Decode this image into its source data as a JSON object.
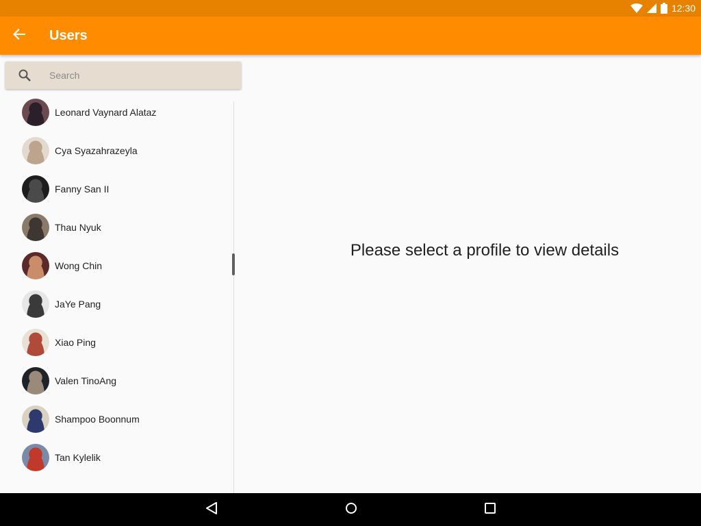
{
  "status_bar": {
    "time": "12:30",
    "icons": [
      "wifi-icon",
      "signal-icon",
      "battery-icon"
    ]
  },
  "app_bar": {
    "title": "Users",
    "back_icon": "arrow-back-icon",
    "color": "#ff8c00"
  },
  "search": {
    "placeholder": "Search",
    "value": "",
    "icon": "search-icon"
  },
  "users": [
    {
      "name": "Leonard Vaynard Alataz",
      "avatar_colors": [
        "#6b4a52",
        "#2b1f2a"
      ]
    },
    {
      "name": "Cya Syazahrazeyla",
      "avatar_colors": [
        "#e4d9cf",
        "#bda48c"
      ]
    },
    {
      "name": "Fanny San II",
      "avatar_colors": [
        "#1d1d1d",
        "#4a4a4a"
      ]
    },
    {
      "name": "Thau Nyuk",
      "avatar_colors": [
        "#8a7a6a",
        "#3e3630"
      ]
    },
    {
      "name": "Wong Chin",
      "avatar_colors": [
        "#5a2a2a",
        "#c98d6a"
      ]
    },
    {
      "name": "JaYe Pang",
      "avatar_colors": [
        "#e6e6e6",
        "#3a3a3a"
      ]
    },
    {
      "name": "Xiao Ping",
      "avatar_colors": [
        "#e8e1d6",
        "#b04a3a"
      ]
    },
    {
      "name": "Valen TinoAng",
      "avatar_colors": [
        "#1f2328",
        "#9a8a7a"
      ]
    },
    {
      "name": "Shampoo Boonnum",
      "avatar_colors": [
        "#d9d2c3",
        "#2e3a6e"
      ]
    },
    {
      "name": "Tan Kylelik",
      "avatar_colors": [
        "#7a8aa8",
        "#c0392b"
      ]
    }
  ],
  "detail": {
    "message": "Please select a profile to view details"
  },
  "nav_bar": {
    "buttons": [
      "nav-back-icon",
      "nav-home-icon",
      "nav-recent-icon"
    ]
  }
}
